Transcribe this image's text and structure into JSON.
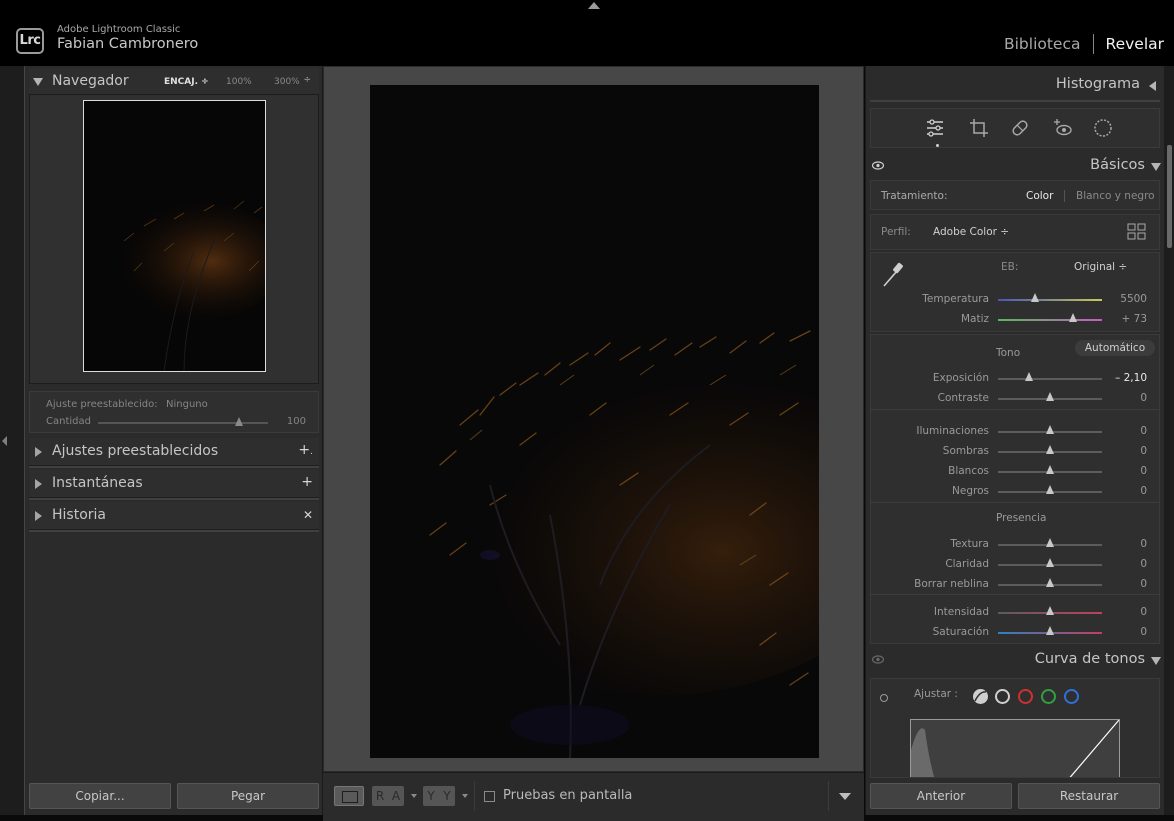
{
  "app": {
    "name": "Adobe Lightroom Classic",
    "logo_text": "Lrc",
    "user": "Fabian Cambronero"
  },
  "modules": {
    "library": "Biblioteca",
    "develop": "Revelar",
    "active": "Revelar"
  },
  "navigator": {
    "title": "Navegador",
    "fit": "ENCAJ. ÷",
    "zoom1": "100%",
    "zoom2": "300%",
    "updown": "÷"
  },
  "preset_box": {
    "preset_label": "Ajuste preestablecido:",
    "preset_value": "Ninguno",
    "amount_label": "Cantidad",
    "amount_value": "100",
    "amount_fraction": 0.83
  },
  "left_panels": [
    {
      "title": "Ajustes preestablecidos",
      "action": "+",
      "suffix": "."
    },
    {
      "title": "Instantáneas",
      "action": "+"
    },
    {
      "title": "Historia",
      "action": "✕"
    }
  ],
  "left_buttons": {
    "copy": "Copiar...",
    "paste": "Pegar"
  },
  "toolbar": {
    "group1": [
      "R",
      "A"
    ],
    "group2": [
      "Y",
      "Y"
    ],
    "softproof": "Pruebas en pantalla"
  },
  "right": {
    "histogram_title": "Histograma",
    "tools": [
      "sliders-icon",
      "crop-icon",
      "healing-icon",
      "redeye-icon",
      "masking-icon"
    ],
    "basics_title": "Básicos",
    "treatment": {
      "label": "Tratamiento:",
      "color": "Color",
      "bw": "Blanco y negro"
    },
    "profile": {
      "label": "Perfil:",
      "value": "Adobe Color ÷"
    },
    "wb": {
      "label": "EB:",
      "value": "Original ÷"
    },
    "wb_sliders": [
      {
        "name": "Temperatura",
        "value": "5500",
        "pos": 0.36
      },
      {
        "name": "Matiz",
        "value": "+ 73",
        "pos": 0.72
      }
    ],
    "tone_label": "Tono",
    "auto_label": "Automático",
    "tone_sliders": [
      {
        "name": "Exposición",
        "value": "– 2,10",
        "pos": 0.3
      },
      {
        "name": "Contraste",
        "value": "0",
        "pos": 0.5
      }
    ],
    "tone_sliders2": [
      {
        "name": "Iluminaciones",
        "value": "0",
        "pos": 0.5
      },
      {
        "name": "Sombras",
        "value": "0",
        "pos": 0.5
      },
      {
        "name": "Blancos",
        "value": "0",
        "pos": 0.5
      },
      {
        "name": "Negros",
        "value": "0",
        "pos": 0.5
      }
    ],
    "presence_label": "Presencia",
    "presence_sliders": [
      {
        "name": "Textura",
        "value": "0",
        "pos": 0.5
      },
      {
        "name": "Claridad",
        "value": "0",
        "pos": 0.5
      },
      {
        "name": "Borrar neblina",
        "value": "0",
        "pos": 0.5
      }
    ],
    "presence_sliders2": [
      {
        "name": "Intensidad",
        "value": "0",
        "pos": 0.5
      },
      {
        "name": "Saturación",
        "value": "0",
        "pos": 0.5
      }
    ],
    "curve_title": "Curva de tonos",
    "curve_adjust": "Ajustar :",
    "buttons": {
      "prev": "Anterior",
      "reset": "Restaurar"
    }
  }
}
